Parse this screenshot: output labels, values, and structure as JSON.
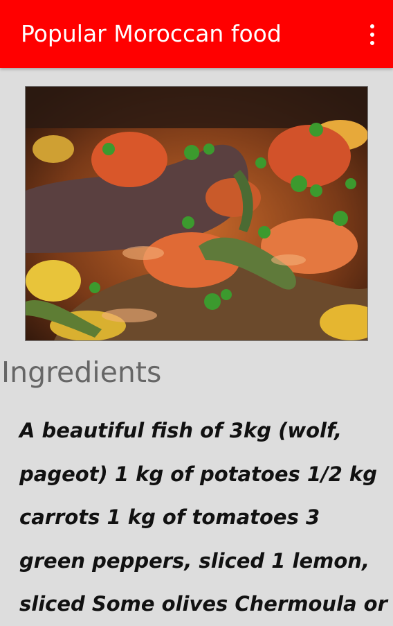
{
  "app_bar": {
    "title": "Popular Moroccan food",
    "menu_icon": "more-vert-icon",
    "color": "#ff0000"
  },
  "image": {
    "icon": "fish-dish-photo"
  },
  "section": {
    "heading": "Ingredients",
    "lines": [
      " A beautiful fish of 3kg (wolf,",
      "pageot)  1 kg of potatoes  1/2 kg",
      "carrots  1 kg of tomatoes  3",
      "green peppers, sliced  1 lemon,",
      "sliced Some olives  Chermoula or"
    ]
  }
}
